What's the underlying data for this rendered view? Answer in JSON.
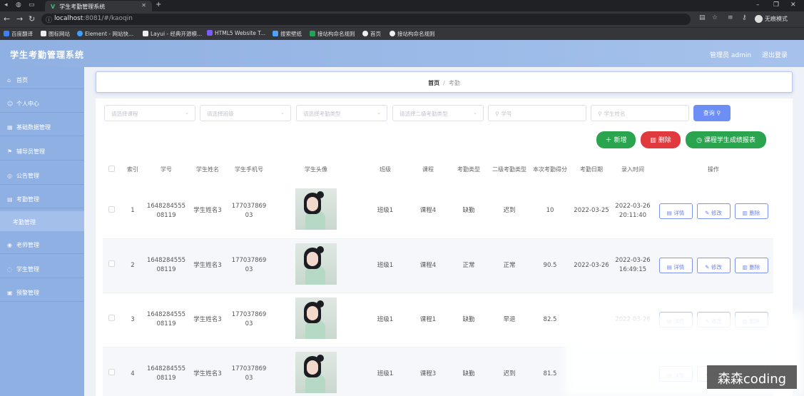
{
  "browser": {
    "tab_title": "学生考勤管理系统",
    "url_host": "localhost",
    "url_port": ":8081",
    "url_path": "/#/kaoqin",
    "profile_label": "无痕模式",
    "bookmarks": [
      {
        "label": "百度翻译",
        "color": "#3b82f6"
      },
      {
        "label": "图标网站",
        "color": "#eeeeee"
      },
      {
        "label": "Element - 网站快...",
        "color": "#409eff"
      },
      {
        "label": "Layui - 经典开源模...",
        "color": "#eeeeee"
      },
      {
        "label": "HTML5 Website T...",
        "color": "#7c5cff"
      },
      {
        "label": "搜索壁纸",
        "color": "#4ca3ff"
      },
      {
        "label": "接站构命名规则",
        "color": "#22a35a"
      },
      {
        "label": "首页",
        "color": "#eeeeee"
      },
      {
        "label": "接站构命名规则",
        "color": "#eeeeee"
      }
    ]
  },
  "header": {
    "title": "学生考勤管理系统",
    "admin_label": "管理员 admin",
    "logout_label": "退出登录"
  },
  "sidebar": {
    "items": [
      {
        "label": "首页",
        "icon": "home-icon",
        "glyph": "⌂"
      },
      {
        "label": "个人中心",
        "icon": "user-icon",
        "glyph": "☺"
      },
      {
        "label": "基础数据管理",
        "icon": "grid-icon",
        "glyph": "▦"
      },
      {
        "label": "辅导员管理",
        "icon": "flag-icon",
        "glyph": "⚑"
      },
      {
        "label": "公告管理",
        "icon": "bell-icon",
        "glyph": "◎"
      },
      {
        "label": "考勤管理",
        "icon": "calendar-icon",
        "glyph": "▤"
      },
      {
        "label": "考勤管理",
        "icon": "",
        "glyph": ""
      },
      {
        "label": "老师管理",
        "icon": "teacher-icon",
        "glyph": "◉"
      },
      {
        "label": "学生管理",
        "icon": "student-icon",
        "glyph": "◌"
      },
      {
        "label": "预警管理",
        "icon": "warning-icon",
        "glyph": "▣"
      }
    ]
  },
  "breadcrumb": {
    "home": "首页",
    "current": "考勤"
  },
  "filters": {
    "course": "请选择课程",
    "class": "请选择班级",
    "type": "请选择考勤类型",
    "type2": "请选择二级考勤类型",
    "student_no": "学号",
    "student_name": "学生姓名"
  },
  "toolbar": {
    "query": "查询",
    "add": "新增",
    "delete": "删除",
    "report": "课程学生成绩报表"
  },
  "table": {
    "headers": {
      "index": "索引",
      "student_no": "学号",
      "name": "学生姓名",
      "phone": "学生手机号",
      "avatar": "学生头像",
      "class": "班级",
      "course": "课程",
      "type": "考勤类型",
      "type2": "二级考勤类型",
      "score": "本次考勤得分",
      "date": "考勤日期",
      "entry_time": "录入时间",
      "actions": "操作"
    },
    "ops": {
      "detail": "详情",
      "edit": "修改",
      "delete": "删除"
    },
    "rows": [
      {
        "index": "1",
        "student_no": "1648284555 08119",
        "name": "学生姓名3",
        "phone": "177037869 03",
        "class": "班级1",
        "course": "课程4",
        "type": "缺勤",
        "type2": "迟到",
        "score": "10",
        "date": "2022-03-25",
        "entry_time": "2022-03-26 20:11:40"
      },
      {
        "index": "2",
        "student_no": "1648284555 08119",
        "name": "学生姓名3",
        "phone": "177037869 03",
        "class": "班级1",
        "course": "课程4",
        "type": "正常",
        "type2": "正常",
        "score": "90.5",
        "date": "2022-03-26",
        "entry_time": "2022-03-26 16:49:15"
      },
      {
        "index": "3",
        "student_no": "1648284555 08119",
        "name": "学生姓名3",
        "phone": "177037869 03",
        "class": "班级1",
        "course": "课程1",
        "type": "缺勤",
        "type2": "早退",
        "score": "82.5",
        "date": "",
        "entry_time": "2022-03-26"
      },
      {
        "index": "4",
        "student_no": "1648284555 08119",
        "name": "学生姓名3",
        "phone": "177037869 03",
        "class": "班级1",
        "course": "课程3",
        "type": "缺勤",
        "type2": "迟到",
        "score": "81.5",
        "date": "",
        "entry_time": ""
      }
    ]
  },
  "watermark": "森森coding"
}
